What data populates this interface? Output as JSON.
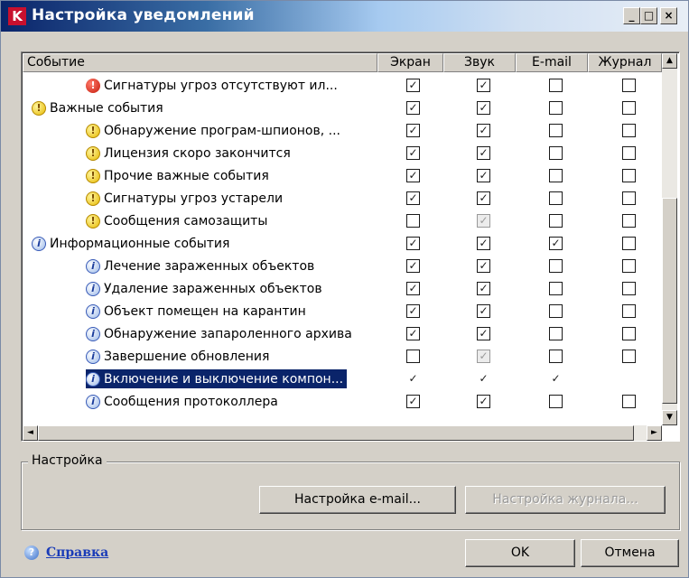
{
  "window": {
    "title": "Настройка уведомлений",
    "app_icon": "kaspersky-k-icon",
    "controls": {
      "minimize": "_",
      "maximize": "□",
      "close": "×"
    }
  },
  "table": {
    "columns": [
      "Событие",
      "Экран",
      "Звук",
      "E-mail",
      "Журнал"
    ],
    "sort_indicator": "▲",
    "rows": [
      {
        "icon": "error",
        "glyph": "!",
        "label": "Сигнатуры угроз отсутствуют ил...",
        "level": 2,
        "checks": [
          "on",
          "on",
          "off",
          "off"
        ]
      },
      {
        "icon": "warning",
        "glyph": "!",
        "label": "Важные события",
        "level": 1,
        "checks": [
          "on",
          "on",
          "off",
          "off"
        ]
      },
      {
        "icon": "warning",
        "glyph": "!",
        "label": "Обнаружение програм-шпионов, ...",
        "level": 2,
        "checks": [
          "on",
          "on",
          "off",
          "off"
        ]
      },
      {
        "icon": "warning",
        "glyph": "!",
        "label": "Лицензия скоро закончится",
        "level": 2,
        "checks": [
          "on",
          "on",
          "off",
          "off"
        ]
      },
      {
        "icon": "warning",
        "glyph": "!",
        "label": "Прочие важные события",
        "level": 2,
        "checks": [
          "on",
          "on",
          "off",
          "off"
        ]
      },
      {
        "icon": "warning",
        "glyph": "!",
        "label": "Сигнатуры угроз устарели",
        "level": 2,
        "checks": [
          "on",
          "on",
          "off",
          "off"
        ]
      },
      {
        "icon": "warning",
        "glyph": "!",
        "label": "Сообщения самозащиты",
        "level": 2,
        "checks": [
          "off",
          "gray",
          "off",
          "off"
        ]
      },
      {
        "icon": "info",
        "glyph": "i",
        "label": "Информационные события",
        "level": 1,
        "checks": [
          "on",
          "on",
          "on",
          "off"
        ]
      },
      {
        "icon": "info",
        "glyph": "i",
        "label": "Лечение зараженных объектов",
        "level": 2,
        "checks": [
          "on",
          "on",
          "off",
          "off"
        ]
      },
      {
        "icon": "info",
        "glyph": "i",
        "label": "Удаление зараженных объектов",
        "level": 2,
        "checks": [
          "on",
          "on",
          "off",
          "off"
        ]
      },
      {
        "icon": "info",
        "glyph": "i",
        "label": "Объект помещен на карантин",
        "level": 2,
        "checks": [
          "on",
          "on",
          "off",
          "off"
        ]
      },
      {
        "icon": "info",
        "glyph": "i",
        "label": "Обнаружение запароленного архива",
        "level": 2,
        "checks": [
          "on",
          "on",
          "off",
          "off"
        ]
      },
      {
        "icon": "info",
        "glyph": "i",
        "label": "Завершение обновления",
        "level": 2,
        "checks": [
          "off",
          "gray",
          "off",
          "off"
        ]
      },
      {
        "icon": "info",
        "glyph": "i",
        "label": "Включение и выключение компон...",
        "level": 2,
        "selected": true,
        "checks": [
          "on",
          "on",
          "on",
          "off"
        ]
      },
      {
        "icon": "info",
        "glyph": "i",
        "label": "Сообщения протоколлера",
        "level": 2,
        "checks": [
          "on",
          "on",
          "off",
          "off"
        ]
      }
    ]
  },
  "scroll": {
    "up": "▲",
    "down": "▼",
    "left": "◄",
    "right": "►"
  },
  "settings_group": {
    "title": "Настройка",
    "email_button": "Настройка e-mail...",
    "journal_button": "Настройка журнала..."
  },
  "footer": {
    "help_link": "Справка",
    "help_icon": "question-icon",
    "ok_button": "OK",
    "cancel_button": "Отмена"
  },
  "colors": {
    "selection": "#0a246a",
    "accent": "#0a246a",
    "dialog_bg": "#d4d0c8"
  }
}
